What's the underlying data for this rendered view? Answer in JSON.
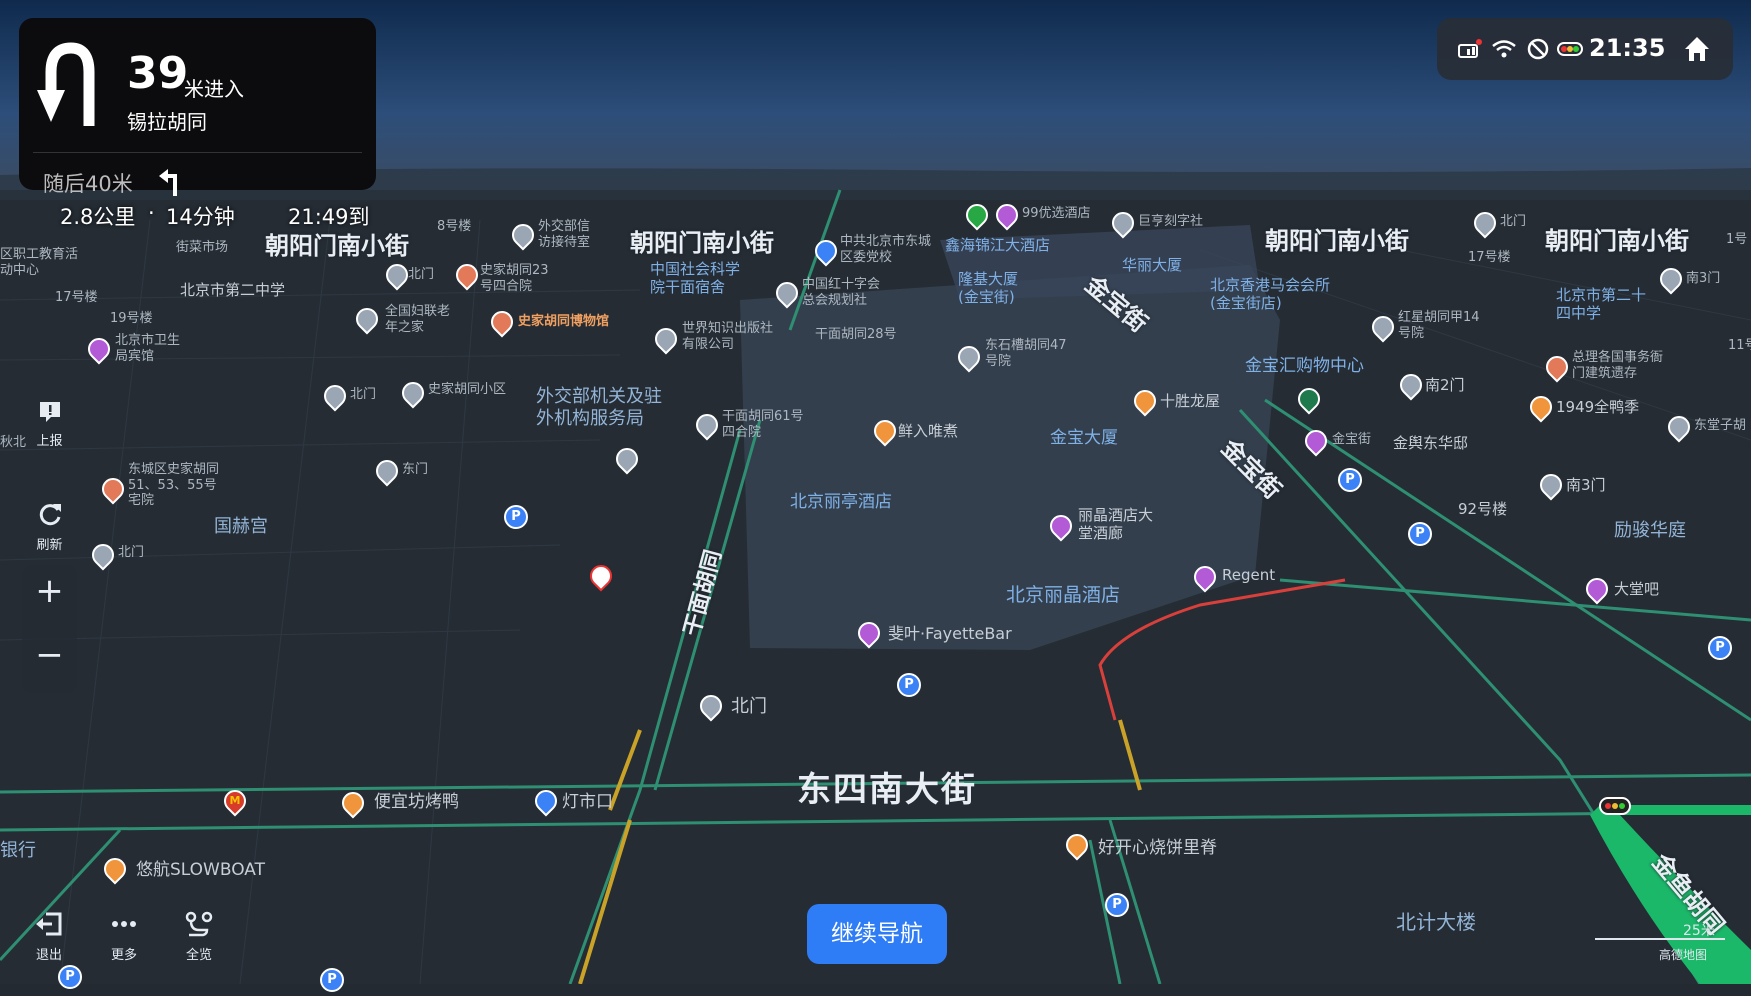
{
  "navigation": {
    "distance": "39",
    "distance_unit": "米进入",
    "road": "锡拉胡同",
    "next_turn": "随后40米",
    "remaining_distance": "2.8公里",
    "separator": "·",
    "remaining_time": "14分钟",
    "arrival": "21:49到"
  },
  "status_bar": {
    "time": "21:35",
    "icons": [
      "car-signal-icon",
      "wifi-icon",
      "no-signal-icon",
      "traffic-light-icon",
      "home-icon"
    ]
  },
  "left_controls": {
    "report": "上报",
    "refresh": "刷新",
    "zoom_in": "+",
    "zoom_out": "−"
  },
  "bottom_controls": {
    "exit": "退出",
    "more": "更多",
    "overview": "全览",
    "continue_nav": "继续导航"
  },
  "map": {
    "scale": "25米",
    "brand": "高德地图",
    "streets": {
      "s1": "朝阳门南小街",
      "s2": "朝阳门南小街",
      "s3": "朝阳门南小街",
      "s4": "朝阳门南小街",
      "dongsi": "东四南大街",
      "jinbao1": "金宝街",
      "jinbao2": "金宝街",
      "qianmian": "干面胡同",
      "jinyu": "金鱼胡同"
    },
    "pois": {
      "p_8hao": "8号楼",
      "p_waijiao": "外交部信访接待室",
      "p_beimen1": "北门",
      "p_shijia23": "史家胡同23号四合院",
      "p_edu": "区职工教育活动中心",
      "p_market": "街菜市场",
      "p_17a": "17号楼",
      "p_19": "19号楼",
      "p_bj2": "北京市第二中学",
      "p_fulian": "全国妇联老年之家",
      "p_museum": "史家胡同博物馆",
      "p_weisheng": "北京市卫生局宾馆",
      "p_beimen2": "北门",
      "p_shijiaxq": "史家胡同小区",
      "p_waijiaobu": "外交部机关及驻外机构服务局",
      "p_dongmen": "东门",
      "p_shijia51": "东城区史家胡同51、53、55号宅院",
      "p_guohe": "国赫宫",
      "p_beimen3": "北门",
      "p_shehui": "中国社会科学院干面宿舍",
      "p_hongshi": "中国红十字会总会规划社",
      "p_zhishi": "世界知识出版社有限公司",
      "p_qm28": "干面胡同28号",
      "p_qm61": "干面胡同61号四合院",
      "p_xianru": "鲜入唯煮",
      "p_liting": "北京丽亭酒店",
      "p_zhonggong": "中共北京市东城区委党校",
      "p_xinhai": "鑫海锦江大酒店",
      "p_99": "99优选酒店",
      "p_juheng": "巨亨刻字社",
      "p_longji": "隆基大厦(金宝街)",
      "p_huali": "华丽大厦",
      "p_dsc47": "东石槽胡同47号院",
      "p_shisheng": "十胜龙屋",
      "p_jinbaodasha": "金宝大厦",
      "p_lijing_tang": "丽晶酒店大堂酒廊",
      "p_lijing": "北京丽晶酒店",
      "p_regent": "Regent",
      "p_fayette": "斐叶·FayetteBar",
      "p_beimen4": "北门",
      "p_xianggang": "北京香港马会会所(金宝街店)",
      "p_jinbaohui": "金宝汇购物中心",
      "p_jinbaojie": "金宝街",
      "p_jinyu_dong": "金舆东华邸",
      "p_hongxing": "红星胡同甲14号院",
      "p_nan2": "南2门",
      "p_92": "92号楼",
      "p_beimen5": "北门",
      "p_17b": "17号楼",
      "p_nan3a": "南3门",
      "p_bj24": "北京市第二十四中学",
      "p_zongli": "总理各国事务衙门建筑遗存",
      "p_1949": "1949全鸭季",
      "p_dongtang": "东堂子胡",
      "p_nan3b": "南3门",
      "p_lijun": "励骏华庭",
      "p_datang": "大堂吧",
      "p_11": "11号",
      "p_bianyi": "便宜坊烤鸭",
      "p_dengshi": "灯市口",
      "p_haokaixin": "好开心烧饼里脊",
      "p_slowboat": "悠航SLOWBOAT",
      "p_yinhang": "银行",
      "p_beiji": "北计大楼",
      "p_qiu": "秋北",
      "p_1hao": "1号"
    }
  }
}
